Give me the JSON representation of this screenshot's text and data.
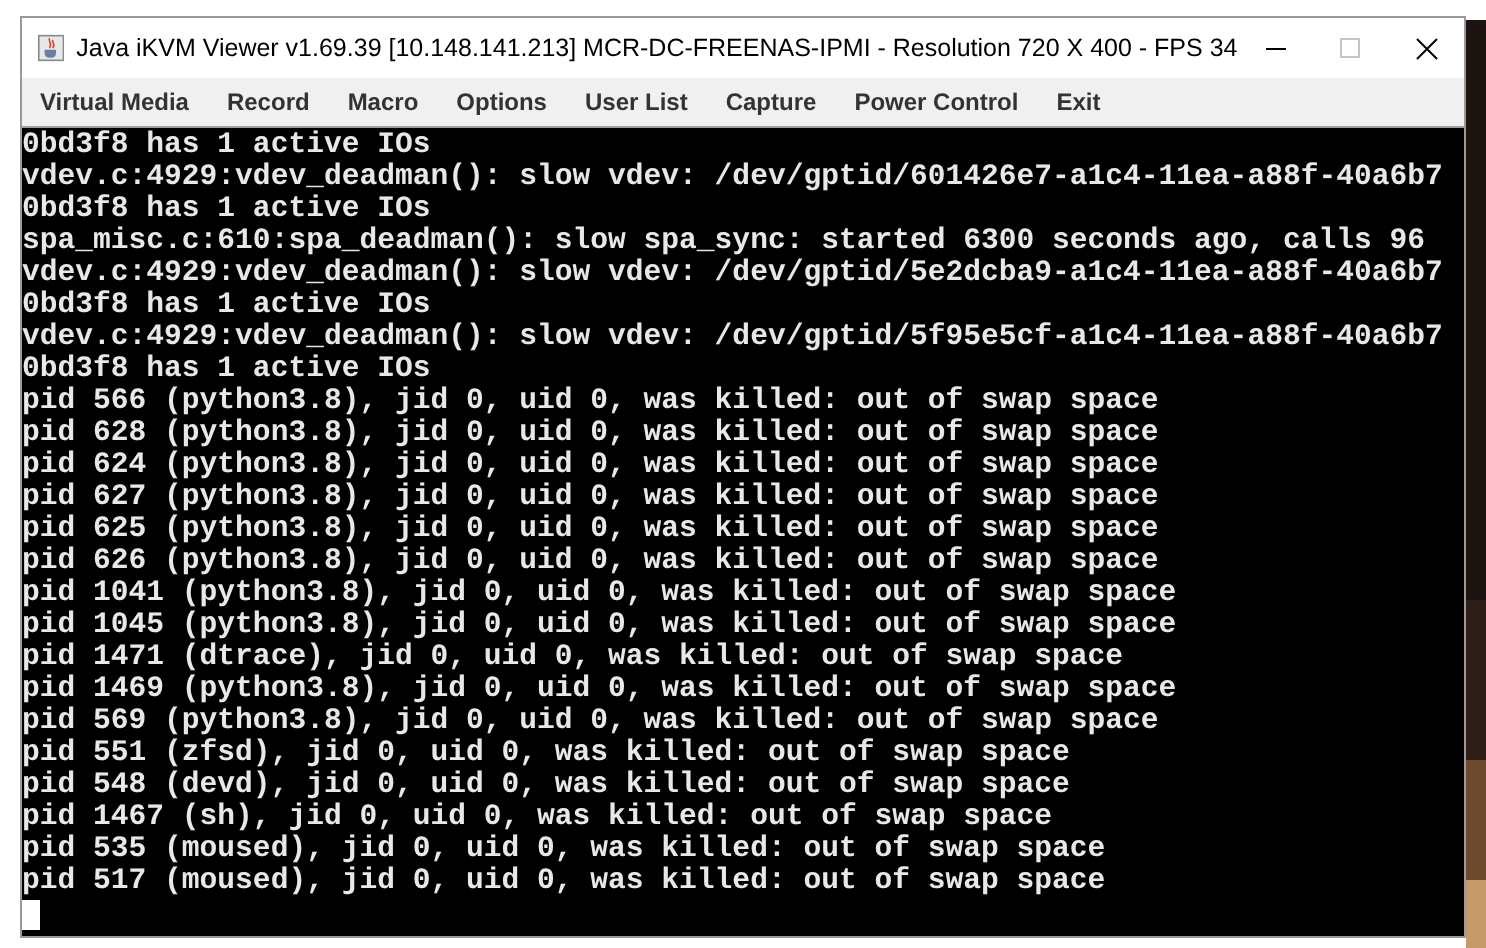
{
  "window": {
    "title": "Java iKVM Viewer v1.69.39 [10.148.141.213] MCR-DC-FREENAS-IPMI - Resolution 720 X 400 - FPS 34"
  },
  "menu": [
    "Virtual Media",
    "Record",
    "Macro",
    "Options",
    "User List",
    "Capture",
    "Power Control",
    "Exit"
  ],
  "console": {
    "lines": [
      "0bd3f8 has 1 active IOs",
      "vdev.c:4929:vdev_deadman(): slow vdev: /dev/gptid/601426e7-a1c4-11ea-a88f-40a6b7",
      "0bd3f8 has 1 active IOs",
      "spa_misc.c:610:spa_deadman(): slow spa_sync: started 6300 seconds ago, calls 96",
      "vdev.c:4929:vdev_deadman(): slow vdev: /dev/gptid/5e2dcba9-a1c4-11ea-a88f-40a6b7",
      "0bd3f8 has 1 active IOs",
      "vdev.c:4929:vdev_deadman(): slow vdev: /dev/gptid/5f95e5cf-a1c4-11ea-a88f-40a6b7",
      "0bd3f8 has 1 active IOs",
      "pid 566 (python3.8), jid 0, uid 0, was killed: out of swap space",
      "pid 628 (python3.8), jid 0, uid 0, was killed: out of swap space",
      "pid 624 (python3.8), jid 0, uid 0, was killed: out of swap space",
      "pid 627 (python3.8), jid 0, uid 0, was killed: out of swap space",
      "pid 625 (python3.8), jid 0, uid 0, was killed: out of swap space",
      "pid 626 (python3.8), jid 0, uid 0, was killed: out of swap space",
      "pid 1041 (python3.8), jid 0, uid 0, was killed: out of swap space",
      "pid 1045 (python3.8), jid 0, uid 0, was killed: out of swap space",
      "pid 1471 (dtrace), jid 0, uid 0, was killed: out of swap space",
      "pid 1469 (python3.8), jid 0, uid 0, was killed: out of swap space",
      "pid 569 (python3.8), jid 0, uid 0, was killed: out of swap space",
      "pid 551 (zfsd), jid 0, uid 0, was killed: out of swap space",
      "pid 548 (devd), jid 0, uid 0, was killed: out of swap space",
      "pid 1467 (sh), jid 0, uid 0, was killed: out of swap space",
      "pid 535 (moused), jid 0, uid 0, was killed: out of swap space",
      "pid 517 (moused), jid 0, uid 0, was killed: out of swap space"
    ]
  }
}
